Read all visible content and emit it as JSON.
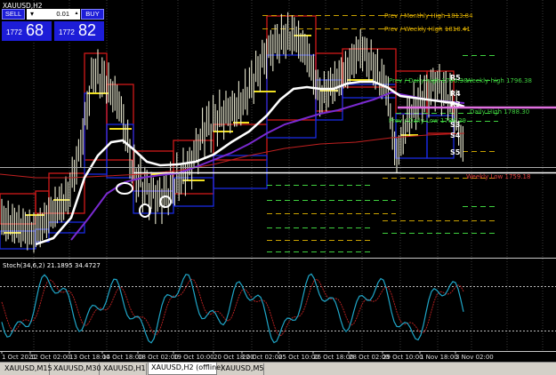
{
  "window": {
    "symbol_title": "XAUUSD,H2",
    "indicator_label": "Stoch(34,6,2) 21.1895 34.4727"
  },
  "trade_panel": {
    "sell_label": "SELL",
    "buy_label": "BUY",
    "lot_value": "0.01",
    "sell_price_small": "1772",
    "sell_price_big": "68",
    "buy_price_small": "1772",
    "buy_price_big": "82"
  },
  "levels": [
    {
      "label": "Prev / Monthly High 1813.84",
      "color": "#e0b000"
    },
    {
      "label": "Prev / Weekly High 1810.41",
      "color": "#e0b000"
    },
    {
      "label": "Prev / Daily high 1796.38",
      "color": "#3fd03f"
    },
    {
      "label": "Weekly high 1796.38",
      "color": "#3fd03f"
    },
    {
      "label": "Daily High 1788.30",
      "color": "#3fd03f"
    },
    {
      "label": "Prev / Daily Low 1786.29",
      "color": "#3fd03f"
    },
    {
      "label": "Weekly Low 1759.18",
      "color": "#e04040"
    }
  ],
  "pivot_labels": [
    "R5",
    "R4",
    "R3",
    "S3",
    "S4",
    "S5"
  ],
  "x_axis_labels": [
    "1 Oct 2021",
    "12 Oct 02:00",
    "13 Oct 18:00",
    "14 Oct 18:00",
    "18 Oct 02:00",
    "19 Oct 10:00",
    "20 Oct 18:00",
    "22 Oct 02:00",
    "25 Oct 10:00",
    "26 Oct 18:00",
    "28 Oct 02:00",
    "29 Oct 10:00",
    "1 Nov 18:00",
    "3 Nov 02:00"
  ],
  "tabs": [
    {
      "label": "XAUUSD,M15",
      "active": false
    },
    {
      "label": "XAUUSD,M30",
      "active": false
    },
    {
      "label": "XAUUSD,H1",
      "active": false
    },
    {
      "label": "XAUUSD,H2 (offline)",
      "active": true
    },
    {
      "label": "XAUUSD,M5",
      "active": false
    }
  ],
  "colors": {
    "background": "#000000",
    "candles": "#e8e8d0",
    "ma_white": "#ffffff",
    "ma_purple": "#7a2ad0",
    "ma_red": "#c02020",
    "box_red": "#d01818",
    "box_blue": "#1a2ae0",
    "stoch_main": "#1fa6c8",
    "stoch_signal": "#b02020",
    "trade_panel": "#1d1dd8"
  }
}
